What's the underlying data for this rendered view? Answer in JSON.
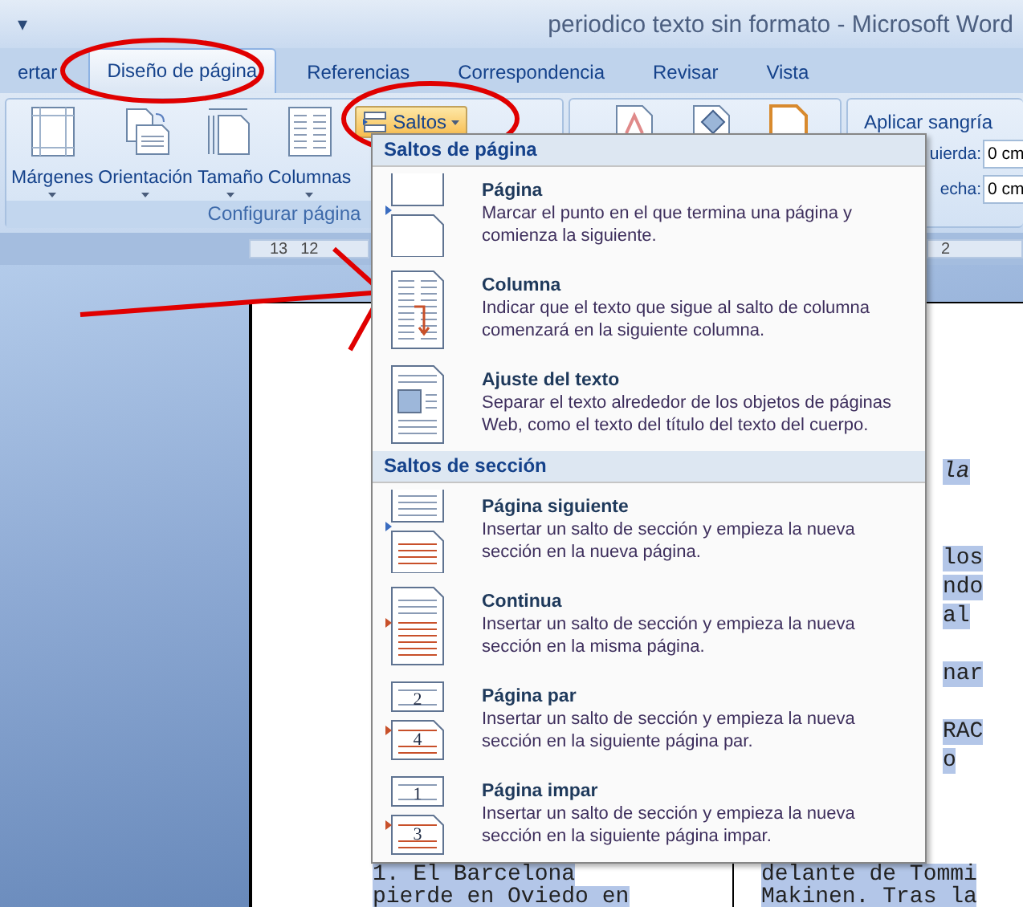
{
  "title_bar": {
    "quick_access": "▾",
    "title": "periodico texto sin formato - Microsoft Word"
  },
  "tabs": [
    {
      "label": "ertar",
      "selected": false
    },
    {
      "label": "Diseño de página",
      "selected": true
    },
    {
      "label": "Referencias",
      "selected": false
    },
    {
      "label": "Correspondencia",
      "selected": false
    },
    {
      "label": "Revisar",
      "selected": false
    },
    {
      "label": "Vista",
      "selected": false
    }
  ],
  "ribbon": {
    "page_setup": {
      "buttons": [
        {
          "kind": "margins",
          "label": "Márgenes"
        },
        {
          "kind": "orientation",
          "label": "Orientación"
        },
        {
          "kind": "size",
          "label": "Tamaño"
        },
        {
          "kind": "columns",
          "label": "Columnas"
        }
      ],
      "breaks_button": {
        "label": "Saltos",
        "pressed": true
      },
      "group_label": "Configurar página"
    },
    "indent_group": {
      "title": "Aplicar sangría",
      "fields": [
        {
          "label": "uierda:",
          "value": "0 cm"
        },
        {
          "label": "echa:",
          "value": "0 cm"
        }
      ]
    }
  },
  "rulers": {
    "left_marks": [
      "13",
      "12"
    ],
    "right_marks": [
      "2"
    ]
  },
  "document": {
    "left_column": [
      "1. El Barcelona",
      "pierde en Oviedo en"
    ],
    "right_column": {
      "fragments": [
        {
          "kind": "text",
          "text": "la",
          "italic": true
        },
        {
          "kind": "blank"
        },
        {
          "kind": "blank"
        },
        {
          "kind": "text",
          "text": "los",
          "italic": false
        },
        {
          "kind": "text",
          "text": "ndo",
          "italic": false
        },
        {
          "kind": "text",
          "text": "al",
          "italic": false
        },
        {
          "kind": "blank"
        },
        {
          "kind": "text",
          "text": "nar",
          "italic": false
        },
        {
          "kind": "blank"
        },
        {
          "kind": "text",
          "text": "RAC",
          "italic": false
        },
        {
          "kind": "text",
          "text": "o",
          "italic": false
        }
      ],
      "lines": [
        "delante de Tommi",
        "Makinen. Tras la"
      ]
    }
  },
  "breaks_menu": {
    "sections": [
      {
        "heading": "Saltos de página",
        "items": [
          {
            "kind": "page",
            "title": "Página",
            "description": [
              "Marcar el punto en el que termina una página y",
              "comienza la siguiente."
            ]
          },
          {
            "kind": "column",
            "title": "Columna",
            "description": [
              "Indicar que el texto que sigue al salto de columna",
              "comenzará en la siguiente columna."
            ]
          },
          {
            "kind": "text-wrap",
            "title": "Ajuste del texto",
            "description": [
              "Separar el texto alrededor de los objetos de páginas",
              "Web, como el texto del título del texto del cuerpo."
            ]
          }
        ]
      },
      {
        "heading": "Saltos de sección",
        "items": [
          {
            "kind": "next-page",
            "title": "Página siguiente",
            "description": [
              "Insertar un salto de sección y empieza la nueva",
              "sección en la nueva página."
            ]
          },
          {
            "kind": "continuous",
            "title": "Continua",
            "description": [
              "Insertar un salto de sección y empieza la nueva",
              "sección en la misma página."
            ]
          },
          {
            "kind": "numbered",
            "title": "Página par",
            "icon_numbers": [
              "2",
              "4"
            ],
            "description": [
              "Insertar un salto de sección y empieza la nueva",
              "sección en la siguiente página par."
            ]
          },
          {
            "kind": "numbered",
            "title": "Página impar",
            "icon_numbers": [
              "1",
              "3"
            ],
            "description": [
              "Insertar un salto de sección y empieza la nueva",
              "sección en la siguiente página impar."
            ]
          }
        ]
      }
    ]
  }
}
